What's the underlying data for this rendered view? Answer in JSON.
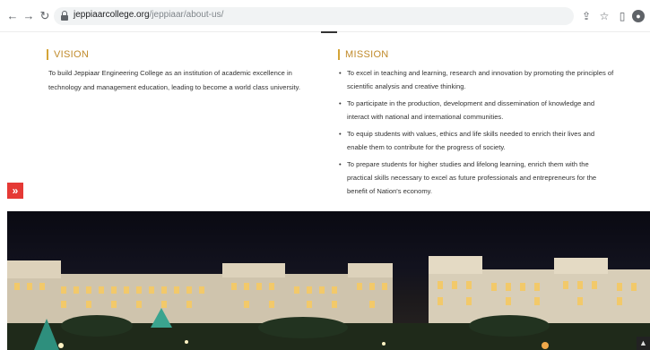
{
  "browser": {
    "url_host": "jeppiaarcollege.org",
    "url_path": "/jeppiaar/about-us/",
    "back_icon": "back-arrow-icon",
    "forward_icon": "forward-arrow-icon",
    "reload_icon": "reload-icon",
    "share_icon": "share-icon",
    "star_icon": "star-icon",
    "sidebar_icon": "side-panel-icon",
    "profile_icon": "profile-icon"
  },
  "vision": {
    "title": "VISION",
    "text": "To build Jeppiaar Engineering College as an institution of academic excellence in technology and management education, leading to become a world class university."
  },
  "mission": {
    "title": "MISSION",
    "items": [
      "To excel in teaching and learning, research and innovation by promoting the principles of scientific analysis and creative thinking.",
      "To participate in the production, development and dissemination of knowledge and interact with national and international communities.",
      "To equip students with values, ethics and life skills needed to enrich their lives and enable them to contribute for the progress of society.",
      "To prepare students for higher studies and lifelong learning, enrich them with the practical skills necessary to excel as future professionals and entrepreneurs for the benefit of Nation's economy."
    ]
  },
  "side_tab": {
    "label": "»"
  },
  "colors": {
    "accent": "#c08a2a",
    "side_tab": "#e53935"
  }
}
